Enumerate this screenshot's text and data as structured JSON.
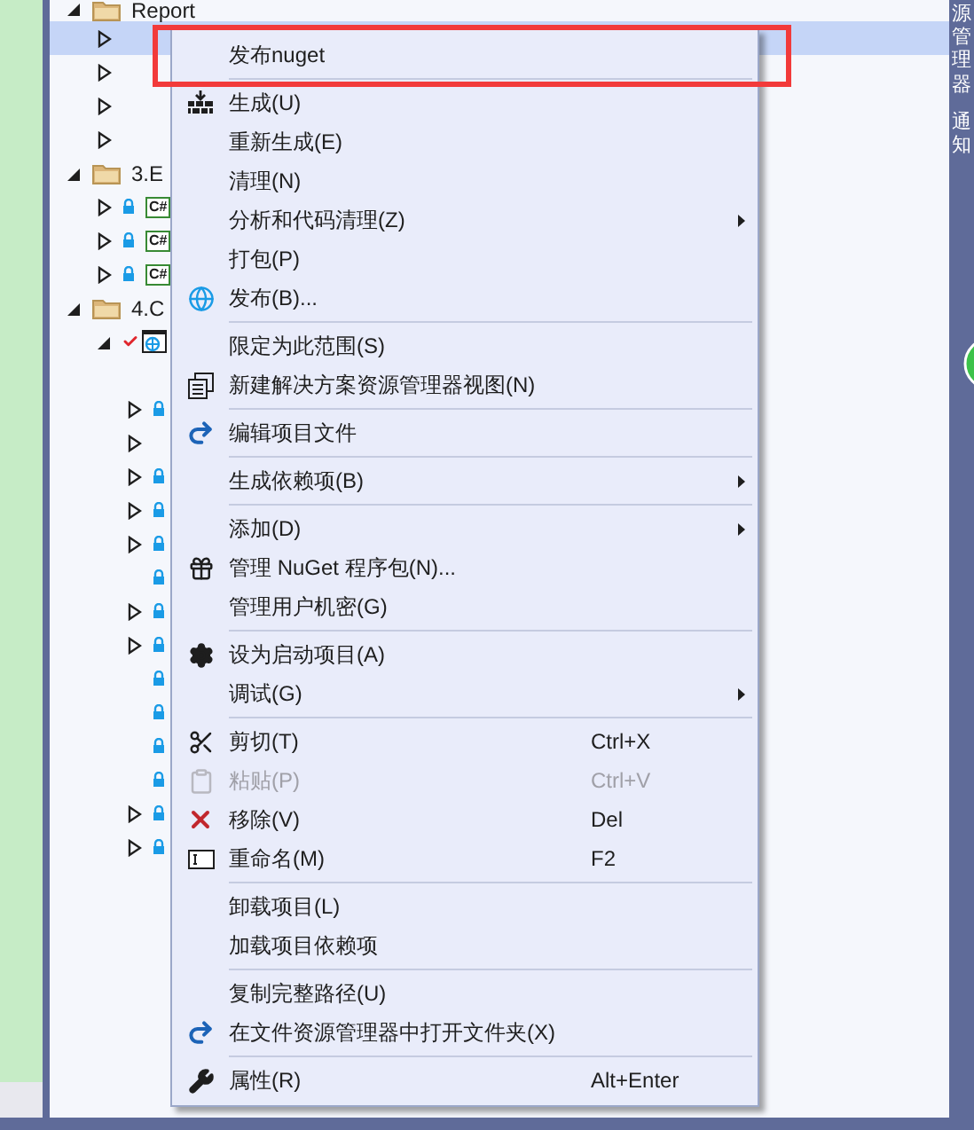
{
  "tree": [
    {
      "label": "Report",
      "kind": "folder",
      "expanded": true,
      "selected": false,
      "children": [
        {
          "expandable": true,
          "selected": true
        },
        {
          "expandable": true,
          "selected": false
        },
        {
          "expandable": true,
          "selected": false
        },
        {
          "expandable": true,
          "selected": false
        }
      ]
    },
    {
      "label": "3.E",
      "kind": "folder",
      "expanded": true,
      "selected": false,
      "children": [
        {
          "kind": "csharp",
          "icon_text": "C#",
          "expandable": true,
          "locked": true,
          "selected": false
        },
        {
          "kind": "csharp",
          "icon_text": "C#",
          "expandable": true,
          "locked": true,
          "selected": false
        },
        {
          "kind": "csharp",
          "icon_text": "C#",
          "expandable": true,
          "locked": true,
          "selected": false
        }
      ]
    },
    {
      "label": "4.C",
      "kind": "folder",
      "expanded": true,
      "selected": false,
      "children": [
        {
          "kind": "web",
          "expanded": true,
          "checked_out": true,
          "selected": false,
          "children": [
            {
              "expandable": false,
              "locked": false,
              "selected": false
            },
            {
              "expandable": true,
              "locked": true,
              "selected": false
            },
            {
              "expandable": true,
              "locked": false,
              "selected": false
            },
            {
              "expandable": true,
              "locked": true,
              "selected": false
            },
            {
              "expandable": true,
              "locked": true,
              "selected": false
            },
            {
              "expandable": true,
              "locked": true,
              "selected": false
            },
            {
              "expandable": false,
              "locked": true,
              "selected": false
            },
            {
              "expandable": true,
              "locked": true,
              "selected": false
            },
            {
              "expandable": true,
              "locked": true,
              "selected": false
            },
            {
              "expandable": false,
              "locked": true,
              "selected": false
            },
            {
              "expandable": false,
              "locked": true,
              "selected": false
            },
            {
              "expandable": false,
              "locked": true,
              "selected": false
            },
            {
              "expandable": false,
              "locked": true,
              "selected": false
            },
            {
              "expandable": true,
              "locked": true,
              "selected": false
            },
            {
              "expandable": true,
              "locked": true,
              "selected": false
            }
          ]
        }
      ]
    }
  ],
  "side_tabs": [
    "源管理器",
    "通知"
  ],
  "context_menu": [
    {
      "kind": "item",
      "label": "发布nuget",
      "submenu": false,
      "disabled": false
    },
    {
      "kind": "separator"
    },
    {
      "kind": "item",
      "label": "生成(U)",
      "submenu": false,
      "disabled": false
    },
    {
      "kind": "item",
      "label": "重新生成(E)",
      "submenu": false,
      "disabled": false
    },
    {
      "kind": "item",
      "label": "清理(N)",
      "submenu": false,
      "disabled": false
    },
    {
      "kind": "item",
      "label": "分析和代码清理(Z)",
      "submenu": true,
      "disabled": false
    },
    {
      "kind": "item",
      "label": "打包(P)",
      "submenu": false,
      "disabled": false
    },
    {
      "kind": "item",
      "label": "发布(B)...",
      "submenu": false,
      "disabled": false
    },
    {
      "kind": "separator"
    },
    {
      "kind": "item",
      "label": "限定为此范围(S)",
      "submenu": false,
      "disabled": false
    },
    {
      "kind": "item",
      "label": "新建解决方案资源管理器视图(N)",
      "submenu": false,
      "disabled": false
    },
    {
      "kind": "separator"
    },
    {
      "kind": "item",
      "label": "编辑项目文件",
      "submenu": false,
      "disabled": false
    },
    {
      "kind": "separator"
    },
    {
      "kind": "item",
      "label": "生成依赖项(B)",
      "submenu": true,
      "disabled": false
    },
    {
      "kind": "separator"
    },
    {
      "kind": "item",
      "label": "添加(D)",
      "submenu": true,
      "disabled": false
    },
    {
      "kind": "item",
      "label": "管理 NuGet 程序包(N)...",
      "submenu": false,
      "disabled": false
    },
    {
      "kind": "item",
      "label": "管理用户机密(G)",
      "submenu": false,
      "disabled": false
    },
    {
      "kind": "separator"
    },
    {
      "kind": "item",
      "label": "设为启动项目(A)",
      "submenu": false,
      "disabled": false
    },
    {
      "kind": "item",
      "label": "调试(G)",
      "submenu": true,
      "disabled": false
    },
    {
      "kind": "separator"
    },
    {
      "kind": "item",
      "label": "剪切(T)",
      "shortcut": "Ctrl+X",
      "submenu": false,
      "disabled": false
    },
    {
      "kind": "item",
      "label": "粘贴(P)",
      "shortcut": "Ctrl+V",
      "submenu": false,
      "disabled": true
    },
    {
      "kind": "item",
      "label": "移除(V)",
      "shortcut": "Del",
      "submenu": false,
      "disabled": false
    },
    {
      "kind": "item",
      "label": "重命名(M)",
      "shortcut": "F2",
      "submenu": false,
      "disabled": false
    },
    {
      "kind": "separator"
    },
    {
      "kind": "item",
      "label": "卸载项目(L)",
      "submenu": false,
      "disabled": false
    },
    {
      "kind": "item",
      "label": "加载项目依赖项",
      "submenu": false,
      "disabled": false
    },
    {
      "kind": "separator"
    },
    {
      "kind": "item",
      "label": "复制完整路径(U)",
      "submenu": false,
      "disabled": false
    },
    {
      "kind": "item",
      "label": "在文件资源管理器中打开文件夹(X)",
      "submenu": false,
      "disabled": false
    },
    {
      "kind": "separator"
    },
    {
      "kind": "item",
      "label": "属性(R)",
      "shortcut": "Alt+Enter",
      "submenu": false,
      "disabled": false
    }
  ]
}
